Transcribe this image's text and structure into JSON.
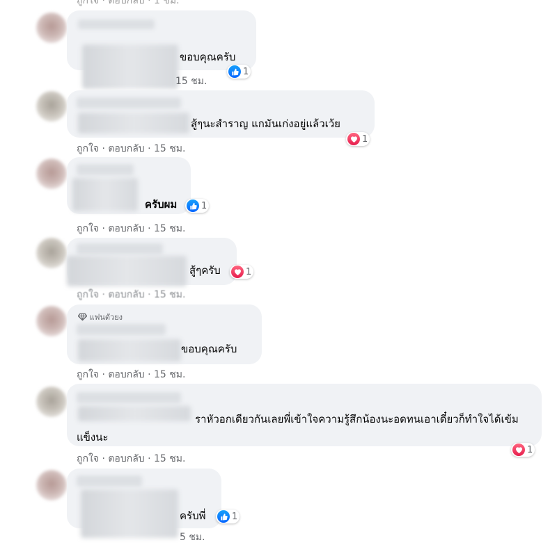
{
  "comments": [
    {
      "text": "ขอบคุณครับ",
      "meta": "15 ชม.",
      "reaction": {
        "type": "like",
        "count": "1"
      }
    },
    {
      "text": "สู้ๆนะสำราญ แกมันเก่งอยู่แล้วเว้ย",
      "meta": "ถูกใจ · ตอบกลับ · 15 ชม.",
      "reaction": {
        "type": "love",
        "count": "1"
      }
    },
    {
      "text": "ครับผม",
      "meta": "ถูกใจ · ตอบกลับ · 15 ชม.",
      "reaction": {
        "type": "like",
        "count": "1"
      }
    },
    {
      "text": "สู้ๆครับ",
      "meta": "ถูกใจ · ตอบกลับ · 15 ชม.",
      "reaction": {
        "type": "love",
        "count": "1"
      }
    },
    {
      "badge": "แฟนตัวยง",
      "text": "ขอบคุณครับ",
      "meta": "ถูกใจ · ตอบกลับ · 15 ชม."
    },
    {
      "text": "ราหัวอกเดียวกันเลยพี่เข้าใจความรู้สึกน้องนะอดทนเอาเดี๋ยวก็ทำใจได้เข้มแข็งนะ",
      "meta": "ถูกใจ · ตอบกลับ · 15 ชม.",
      "reaction": {
        "type": "love",
        "count": "1"
      }
    },
    {
      "text": "ครับพี่",
      "meta": "5 ชม.",
      "reaction": {
        "type": "like",
        "count": "1"
      }
    }
  ]
}
